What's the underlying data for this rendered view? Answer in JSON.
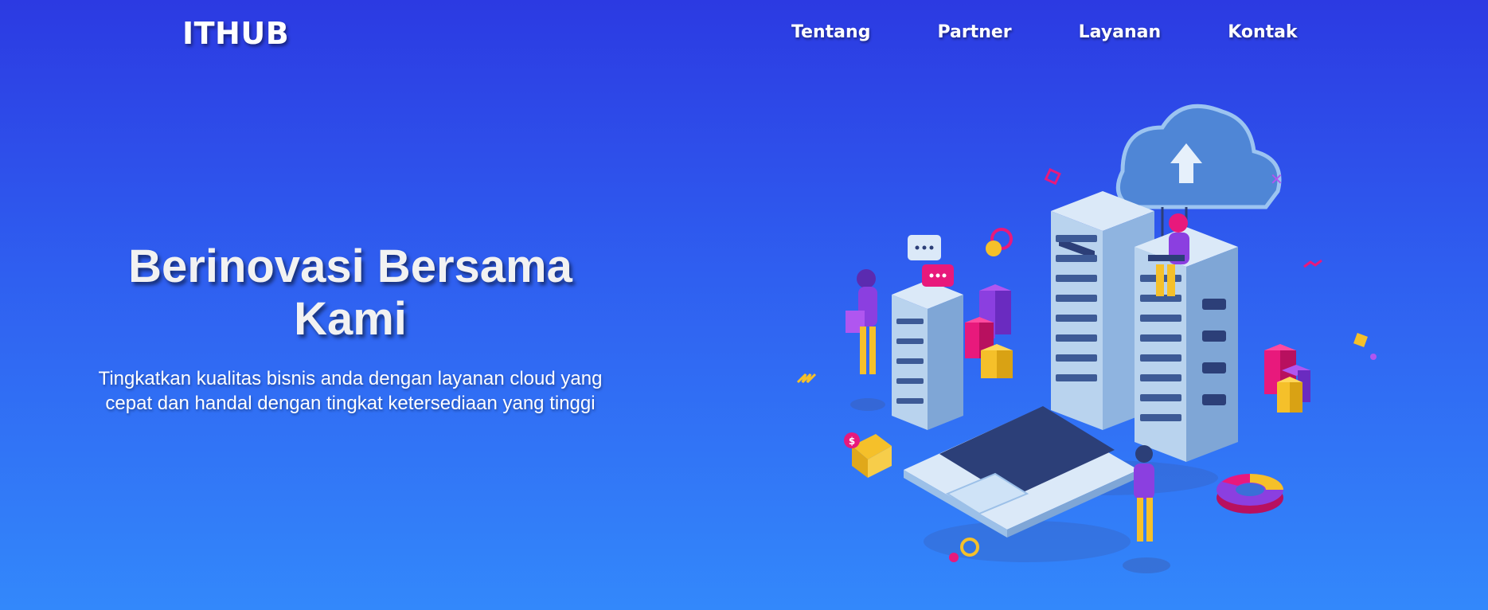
{
  "brand": {
    "logo": "ITHUB"
  },
  "nav": {
    "items": [
      {
        "label": "Tentang"
      },
      {
        "label": "Partner"
      },
      {
        "label": "Layanan"
      },
      {
        "label": "Kontak"
      }
    ]
  },
  "hero": {
    "title": "Berinovasi Bersama Kami",
    "subtitle": "Tingkatkan kualitas bisnis anda dengan layanan cloud yang cepat dan handal dengan tingkat ketersediaan yang tinggi"
  },
  "illustration": {
    "badge_symbol": "$",
    "icon": "cloud-server-isometric-illustration"
  },
  "colors": {
    "bg_top": "#2c3ae2",
    "bg_bottom": "#3388fb",
    "purple": "#8b3fe0",
    "pink": "#e8197c",
    "yellow": "#f5c02a",
    "server_light": "#cfe3f7",
    "server_dark": "#2c3f78"
  }
}
